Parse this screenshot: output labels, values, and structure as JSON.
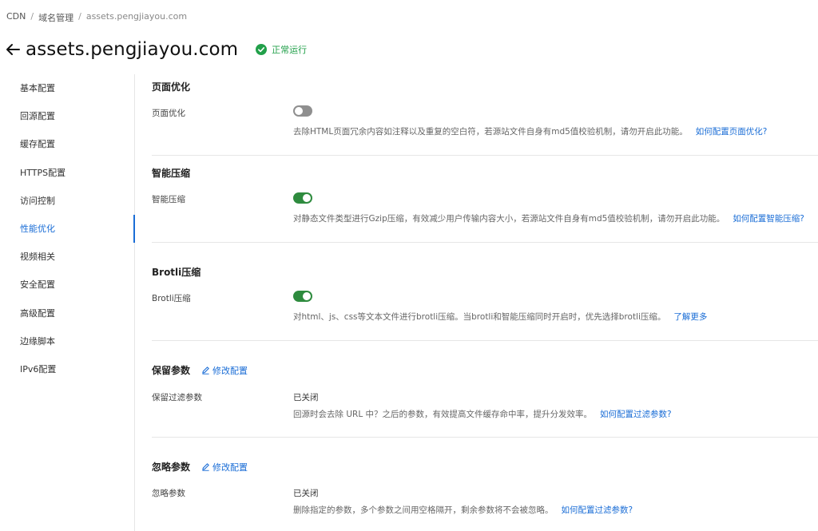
{
  "breadcrumb": {
    "root": "CDN",
    "sep": "/",
    "section": "域名管理",
    "current": "assets.pengjiayou.com"
  },
  "header": {
    "title": "assets.pengjiayou.com",
    "status_label": "正常运行",
    "status_color": "#22a04a"
  },
  "sidebar": {
    "active_index": 5,
    "items": [
      {
        "label": "基本配置"
      },
      {
        "label": "回源配置"
      },
      {
        "label": "缓存配置"
      },
      {
        "label": "HTTPS配置"
      },
      {
        "label": "访问控制"
      },
      {
        "label": "性能优化"
      },
      {
        "label": "视频相关"
      },
      {
        "label": "安全配置"
      },
      {
        "label": "高级配置"
      },
      {
        "label": "边缘脚本"
      },
      {
        "label": "IPv6配置"
      }
    ]
  },
  "sections": {
    "page_opt": {
      "title": "页面优化",
      "label": "页面优化",
      "enabled": false,
      "desc": "去除HTML页面冗余内容如注释以及重复的空白符，若源站文件自身有md5值校验机制，请勿开启此功能。",
      "link": "如何配置页面优化?"
    },
    "smart_compress": {
      "title": "智能压缩",
      "label": "智能压缩",
      "enabled": true,
      "desc": "对静态文件类型进行Gzip压缩，有效减少用户传输内容大小，若源站文件自身有md5值校验机制，请勿开启此功能。",
      "link": "如何配置智能压缩?"
    },
    "brotli": {
      "title": "Brotli压缩",
      "label": "Brotli压缩",
      "enabled": true,
      "desc": "对html、js、css等文本文件进行brotli压缩。当brotli和智能压缩同时开启时，优先选择brotli压缩。",
      "link": "了解更多"
    },
    "keep_params": {
      "title": "保留参数",
      "edit_label": "修改配置",
      "label": "保留过滤参数",
      "value": "已关闭",
      "desc": "回源时会去除 URL 中？之后的参数，有效提高文件缓存命中率，提升分发效率。",
      "link": "如何配置过滤参数?"
    },
    "ignore_params": {
      "title": "忽略参数",
      "edit_label": "修改配置",
      "label": "忽略参数",
      "value": "已关闭",
      "desc": "删除指定的参数，多个参数之间用空格隔开，剩余参数将不会被忽略。",
      "link": "如何配置过滤参数?"
    }
  },
  "colors": {
    "accent": "#1a6dd6",
    "toggle_on": "#2e8b3e",
    "toggle_off": "#8f8f8f"
  }
}
